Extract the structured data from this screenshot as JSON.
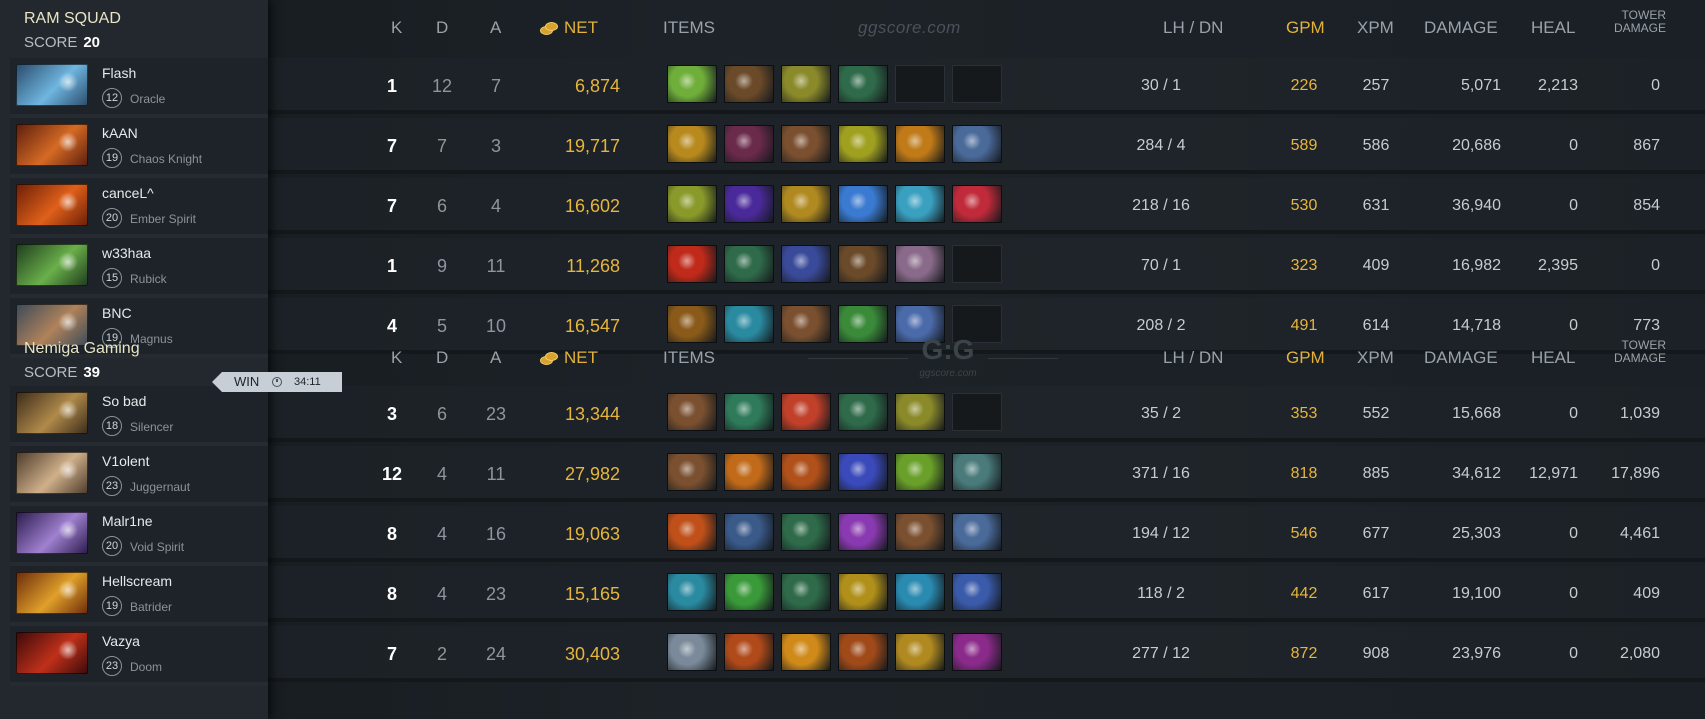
{
  "header": {
    "k": "K",
    "d": "D",
    "a": "A",
    "net": "NET",
    "items": "ITEMS",
    "lh_dn": "LH / DN",
    "gpm": "GPM",
    "xpm": "XPM",
    "damage": "DAMAGE",
    "heal": "HEAL",
    "tower_line1": "TOWER",
    "tower_line2": "DAMAGE",
    "watermark": "ggscore.com",
    "logo_mark": "G:G",
    "logo_sub": "ggscore.com"
  },
  "result": {
    "label": "WIN",
    "duration": "34:11"
  },
  "score_label": "SCORE",
  "teams": [
    {
      "name": "RAM SQUAD",
      "score": "20",
      "players": [
        {
          "name": "Flash",
          "level": "12",
          "hero": "Oracle",
          "k": "1",
          "d": "12",
          "a": "7",
          "net": "6,874",
          "lh_dn": "30  /  1",
          "gpm": "226",
          "xpm": "257",
          "damage": "5,071",
          "heal": "2,213",
          "tower": "0",
          "portrait": [
            "#2a4a6a",
            "#6fb6e0"
          ],
          "items": [
            "#6fae3a",
            "#6b4a2a",
            "#8a8a2a",
            "#2f6b4a",
            "empty",
            "empty"
          ]
        },
        {
          "name": "kAAN",
          "level": "19",
          "hero": "Chaos Knight",
          "k": "7",
          "d": "7",
          "a": "3",
          "net": "19,717",
          "lh_dn": "284  /  4",
          "gpm": "589",
          "xpm": "586",
          "damage": "20,686",
          "heal": "0",
          "tower": "867",
          "portrait": [
            "#5a1e0e",
            "#d66a24"
          ],
          "items": [
            "#b88a1e",
            "#6a2a4a",
            "#7a5030",
            "#a0a020",
            "#c07a18",
            "#4a6a9a"
          ]
        },
        {
          "name": "canceL^",
          "level": "20",
          "hero": "Ember Spirit",
          "k": "7",
          "d": "6",
          "a": "4",
          "net": "16,602",
          "lh_dn": "218  /  16",
          "gpm": "530",
          "xpm": "631",
          "damage": "36,940",
          "heal": "0",
          "tower": "854",
          "portrait": [
            "#6a1e08",
            "#e0601a"
          ],
          "items": [
            "#8a9a2a",
            "#4a2a9a",
            "#b08a20",
            "#3a7ad0",
            "#3aa0c0",
            "#c02a3a"
          ]
        },
        {
          "name": "w33haa",
          "level": "15",
          "hero": "Rubick",
          "k": "1",
          "d": "9",
          "a": "11",
          "net": "11,268",
          "lh_dn": "70  /  1",
          "gpm": "323",
          "xpm": "409",
          "damage": "16,982",
          "heal": "2,395",
          "tower": "0",
          "portrait": [
            "#1e3a1e",
            "#6ab04a"
          ],
          "items": [
            "#c02a1a",
            "#2f6b4a",
            "#3a4a9a",
            "#6b4a2a",
            "#8a6a8a",
            "empty"
          ]
        },
        {
          "name": "BNC",
          "level": "19",
          "hero": "Magnus",
          "k": "4",
          "d": "5",
          "a": "10",
          "net": "16,547",
          "lh_dn": "208  /  2",
          "gpm": "491",
          "xpm": "614",
          "damage": "14,718",
          "heal": "0",
          "tower": "773",
          "portrait": [
            "#3a4a5a",
            "#b0825a"
          ],
          "items": [
            "#8a5a1a",
            "#2a8aa0",
            "#7a5030",
            "#3a8a3a",
            "#4a6aaa",
            "empty"
          ]
        }
      ]
    },
    {
      "name": "Nemiga Gaming",
      "score": "39",
      "players": [
        {
          "name": "So bad",
          "level": "18",
          "hero": "Silencer",
          "k": "3",
          "d": "6",
          "a": "23",
          "net": "13,344",
          "lh_dn": "35  /  2",
          "gpm": "353",
          "xpm": "552",
          "damage": "15,668",
          "heal": "0",
          "tower": "1,039",
          "portrait": [
            "#3a2a1a",
            "#b08a4a"
          ],
          "items": [
            "#7a5030",
            "#2f7a5a",
            "#c0402a",
            "#2f6b4a",
            "#8a8a2a",
            "empty"
          ]
        },
        {
          "name": "V1olent",
          "level": "23",
          "hero": "Juggernaut",
          "k": "12",
          "d": "4",
          "a": "11",
          "net": "27,982",
          "lh_dn": "371  /  16",
          "gpm": "818",
          "xpm": "885",
          "damage": "34,612",
          "heal": "12,971",
          "tower": "17,896",
          "portrait": [
            "#4a3a2a",
            "#d0b08a"
          ],
          "items": [
            "#7a5030",
            "#c06a1a",
            "#b0501a",
            "#3a4aba",
            "#6aa02a",
            "#4a7a7a"
          ]
        },
        {
          "name": "Malr1ne",
          "level": "20",
          "hero": "Void Spirit",
          "k": "8",
          "d": "4",
          "a": "16",
          "net": "19,063",
          "lh_dn": "194  /  12",
          "gpm": "546",
          "xpm": "677",
          "damage": "25,303",
          "heal": "0",
          "tower": "4,461",
          "portrait": [
            "#2a1a4a",
            "#a080d0"
          ],
          "items": [
            "#c0501a",
            "#3a5a8a",
            "#2f6b4a",
            "#8a3ab0",
            "#7a5030",
            "#4a6a9a"
          ]
        },
        {
          "name": "Hellscream",
          "level": "19",
          "hero": "Batrider",
          "k": "8",
          "d": "4",
          "a": "23",
          "net": "15,165",
          "lh_dn": "118  /  2",
          "gpm": "442",
          "xpm": "617",
          "damage": "19,100",
          "heal": "0",
          "tower": "409",
          "portrait": [
            "#6a2a0a",
            "#e0a02a"
          ],
          "items": [
            "#2a8aa0",
            "#3a9a3a",
            "#2f6b4a",
            "#b0901a",
            "#2a8ab0",
            "#3a5aaa"
          ]
        },
        {
          "name": "Vazya",
          "level": "23",
          "hero": "Doom",
          "k": "7",
          "d": "2",
          "a": "24",
          "net": "30,403",
          "lh_dn": "277  /  12",
          "gpm": "872",
          "xpm": "908",
          "damage": "23,976",
          "heal": "0",
          "tower": "2,080",
          "portrait": [
            "#3a0a0a",
            "#c0301a"
          ],
          "items": [
            "#7a8a9a",
            "#b04a1a",
            "#d08a1a",
            "#a04a1a",
            "#b08a20",
            "#8a2a8a"
          ]
        }
      ]
    }
  ]
}
